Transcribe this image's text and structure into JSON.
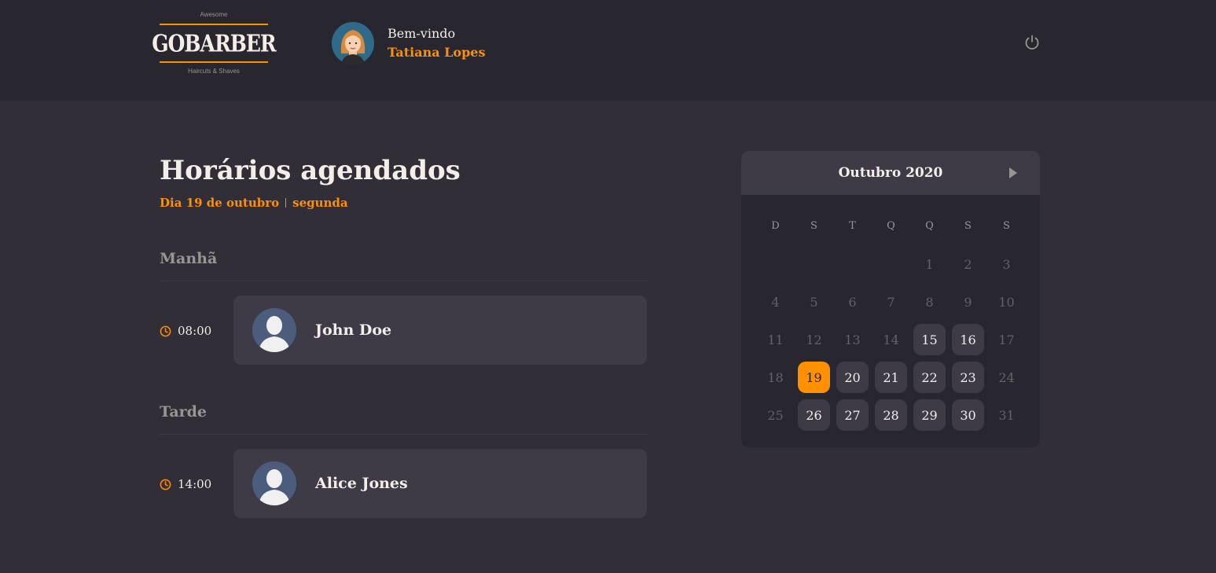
{
  "header": {
    "logo_top": "Awesome",
    "logo_brand": "GOBARBER",
    "logo_bottom": "Haircuts & Shaves",
    "welcome": "Bem-vindo",
    "user_name": "Tatiana Lopes"
  },
  "schedule": {
    "title": "Horários agendados",
    "date_text": "Dia 19 de outubro",
    "weekday_text": "segunda",
    "morning": {
      "label": "Manhã",
      "appointments": [
        {
          "time": "08:00",
          "client": "John Doe"
        }
      ]
    },
    "afternoon": {
      "label": "Tarde",
      "appointments": [
        {
          "time": "14:00",
          "client": "Alice Jones"
        }
      ]
    }
  },
  "calendar": {
    "month_label": "Outubro 2020",
    "weekdays": [
      "D",
      "S",
      "T",
      "Q",
      "Q",
      "S",
      "S"
    ],
    "weeks": [
      [
        {
          "d": ""
        },
        {
          "d": ""
        },
        {
          "d": ""
        },
        {
          "d": ""
        },
        {
          "d": "1",
          "s": "disabled"
        },
        {
          "d": "2",
          "s": "disabled"
        },
        {
          "d": "3",
          "s": "disabled"
        }
      ],
      [
        {
          "d": "4",
          "s": "disabled"
        },
        {
          "d": "5",
          "s": "disabled"
        },
        {
          "d": "6",
          "s": "disabled"
        },
        {
          "d": "7",
          "s": "disabled"
        },
        {
          "d": "8",
          "s": "disabled"
        },
        {
          "d": "9",
          "s": "disabled"
        },
        {
          "d": "10",
          "s": "disabled"
        }
      ],
      [
        {
          "d": "11",
          "s": "disabled"
        },
        {
          "d": "12",
          "s": "disabled"
        },
        {
          "d": "13",
          "s": "disabled"
        },
        {
          "d": "14",
          "s": "disabled"
        },
        {
          "d": "15",
          "s": "available"
        },
        {
          "d": "16",
          "s": "available"
        },
        {
          "d": "17",
          "s": "disabled"
        }
      ],
      [
        {
          "d": "18",
          "s": "disabled"
        },
        {
          "d": "19",
          "s": "selected"
        },
        {
          "d": "20",
          "s": "available"
        },
        {
          "d": "21",
          "s": "available"
        },
        {
          "d": "22",
          "s": "available"
        },
        {
          "d": "23",
          "s": "available"
        },
        {
          "d": "24",
          "s": "disabled"
        }
      ],
      [
        {
          "d": "25",
          "s": "disabled"
        },
        {
          "d": "26",
          "s": "available"
        },
        {
          "d": "27",
          "s": "available"
        },
        {
          "d": "28",
          "s": "available"
        },
        {
          "d": "29",
          "s": "available"
        },
        {
          "d": "30",
          "s": "available"
        },
        {
          "d": "31",
          "s": "disabled"
        }
      ]
    ]
  },
  "colors": {
    "accent": "#ff9000",
    "background": "#312e38",
    "header_bg": "#28262e",
    "card_bg": "#3e3b47"
  },
  "icons": {
    "power": "power-icon",
    "clock": "clock-icon",
    "next": "next-month-icon"
  }
}
